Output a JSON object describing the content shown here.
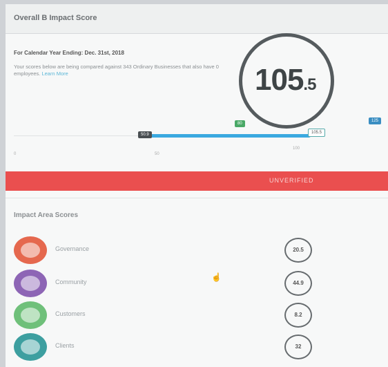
{
  "header": {
    "title": "Overall B Impact Score"
  },
  "summary": {
    "period": "For Calendar Year Ending: Dec. 31st, 2018",
    "description": "Your scores below are being compared against 343 Ordinary Businesses that also have 0 employees.",
    "learn_more": "Learn More",
    "score_int": "105",
    "score_dec": ".5"
  },
  "scale": {
    "markers": [
      {
        "label": "50.9"
      },
      {
        "label": "80"
      },
      {
        "label": "105.5"
      },
      {
        "label": "125"
      }
    ],
    "ticks": [
      "0",
      "50",
      "100"
    ]
  },
  "banner": {
    "label": "UNVERIFIED"
  },
  "impact": {
    "title": "Impact Area Scores",
    "areas": [
      {
        "label": "Governance",
        "score": "20.5",
        "color": "#e5684e",
        "icon": "document-icon"
      },
      {
        "label": "Community",
        "score": "44.9",
        "color": "#8d65b5",
        "icon": "house-icon"
      },
      {
        "label": "Customers",
        "score": "8.2",
        "color": "#6fc07a",
        "icon": "leaf-icon"
      },
      {
        "label": "Clients",
        "score": "32",
        "color": "#3d9fa0",
        "icon": "handshake-icon"
      }
    ]
  }
}
